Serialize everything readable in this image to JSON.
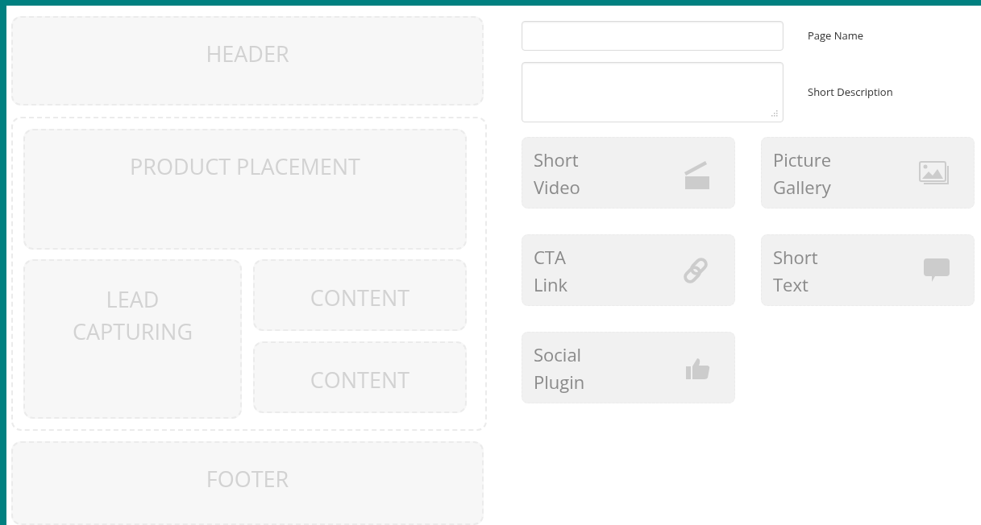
{
  "layout": {
    "header": "HEADER",
    "product": "PRODUCT PLACEMENT",
    "lead": "LEAD CAPTURING",
    "content": [
      "CONTENT",
      "CONTENT"
    ],
    "footer": "FOOTER"
  },
  "fields": [
    {
      "kind": "input",
      "label": "Page Name"
    },
    {
      "kind": "textarea",
      "label": "Short Description"
    }
  ],
  "widgets": [
    {
      "kind": "video",
      "label": "Short Video"
    },
    {
      "kind": "gallery",
      "label": "Picture Gallery"
    },
    {
      "kind": "link",
      "label": "CTA Link"
    },
    {
      "kind": "text",
      "label": "Short Text"
    },
    {
      "kind": "like",
      "label": "Social Plugin"
    }
  ]
}
